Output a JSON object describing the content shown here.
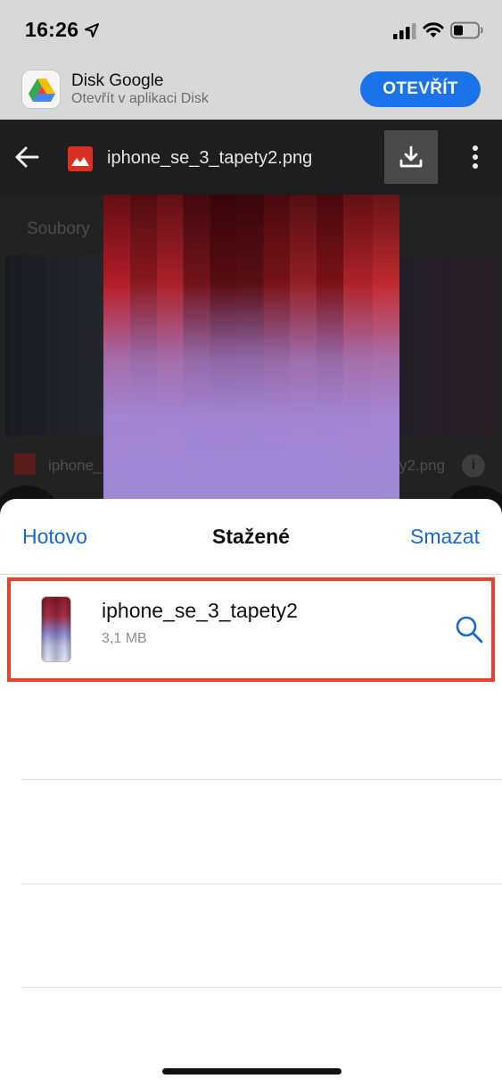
{
  "status_bar": {
    "time": "16:26"
  },
  "app_banner": {
    "app_name": "Disk Google",
    "subtitle": "Otevřít v aplikaci Disk",
    "open_label": "OTEVŘÍT",
    "accent": "#1a73e8"
  },
  "viewer": {
    "file_name": "iphone_se_3_tapety2.png",
    "background_tab": "Soubory",
    "background_row_left": "iphone_",
    "background_row_right": "y2.png",
    "icons": [
      "back-arrow-icon",
      "image-file-icon",
      "download-icon",
      "more-vert-icon",
      "info-icon"
    ]
  },
  "downloads_sheet": {
    "done_label": "Hotovo",
    "title": "Stažené",
    "clear_label": "Smazat",
    "link_color": "#1668d1",
    "highlight_color": "#e8412c",
    "items": [
      {
        "name": "iphone_se_3_tapety2",
        "size": "3,1 MB",
        "action_icon": "search-icon"
      }
    ]
  }
}
